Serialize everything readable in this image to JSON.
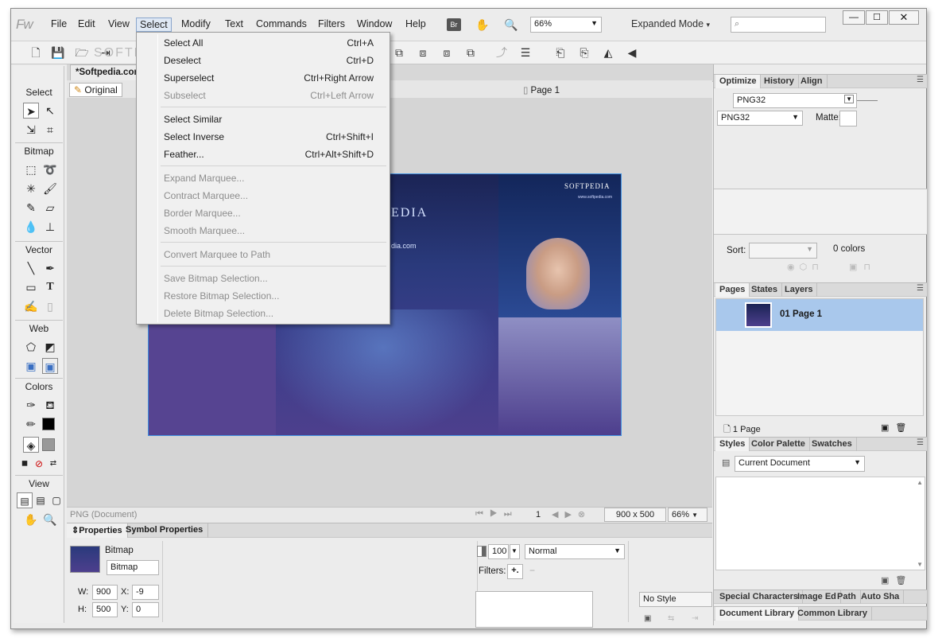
{
  "app": {
    "logo": "Fw",
    "title_close": "✕"
  },
  "menubar": {
    "items": [
      "File",
      "Edit",
      "View",
      "Select",
      "Modify",
      "Text",
      "Commands",
      "Filters",
      "Window",
      "Help"
    ],
    "bridge": "Br",
    "zoom": "66%",
    "mode": "Expanded Mode",
    "search_placeholder": ""
  },
  "toolbar": {
    "watermark": "SOFTPEDIA"
  },
  "tools": {
    "sections": [
      "Select",
      "Bitmap",
      "Vector",
      "Web",
      "Colors",
      "View"
    ]
  },
  "document": {
    "tab_title": "*Softpedia.com",
    "view_original": "Original",
    "page": "Page 1",
    "status_left": "PNG (Document)",
    "frame": "1",
    "size": "900 x 500",
    "zoom": "66%",
    "image_text_title": "SOFTPEDIA",
    "image_text_url": "www.softpedia.com",
    "image_partial_title": "EDIA",
    "image_partial_url": "dia.com"
  },
  "select_menu": {
    "items": [
      {
        "label": "Select All",
        "shortcut": "Ctrl+A",
        "enabled": true
      },
      {
        "label": "Deselect",
        "shortcut": "Ctrl+D",
        "enabled": true
      },
      {
        "label": "Superselect",
        "shortcut": "Ctrl+Right Arrow",
        "enabled": true
      },
      {
        "label": "Subselect",
        "shortcut": "Ctrl+Left Arrow",
        "enabled": false
      },
      {
        "label": "Select Similar",
        "shortcut": "",
        "enabled": true
      },
      {
        "label": "Select Inverse",
        "shortcut": "Ctrl+Shift+I",
        "enabled": true
      },
      {
        "label": "Feather...",
        "shortcut": "Ctrl+Alt+Shift+D",
        "enabled": true
      },
      {
        "label": "Expand Marquee...",
        "shortcut": "",
        "enabled": false
      },
      {
        "label": "Contract Marquee...",
        "shortcut": "",
        "enabled": false
      },
      {
        "label": "Border Marquee...",
        "shortcut": "",
        "enabled": false
      },
      {
        "label": "Smooth Marquee...",
        "shortcut": "",
        "enabled": false
      },
      {
        "label": "Convert Marquee to Path",
        "shortcut": "",
        "enabled": false
      },
      {
        "label": "Save Bitmap Selection...",
        "shortcut": "",
        "enabled": false
      },
      {
        "label": "Restore Bitmap Selection...",
        "shortcut": "",
        "enabled": false
      },
      {
        "label": "Delete Bitmap Selection...",
        "shortcut": "",
        "enabled": false
      }
    ]
  },
  "properties": {
    "tabs": [
      "Properties",
      "Symbol Properties"
    ],
    "type": "Bitmap",
    "name": "Bitmap",
    "w_label": "W:",
    "w": "900",
    "h_label": "H:",
    "h": "500",
    "x_label": "X:",
    "x": "-9",
    "y_label": "Y:",
    "y": "0",
    "opacity": "100",
    "blend": "Normal",
    "filters_label": "Filters:",
    "style": "No Style"
  },
  "optimize_panel": {
    "tabs": [
      "Optimize",
      "History",
      "Align"
    ],
    "format_top": "PNG32",
    "format": "PNG32",
    "matte_label": "Matte:",
    "sort_label": "Sort:",
    "colors": "0 colors"
  },
  "pages_panel": {
    "tabs": [
      "Pages",
      "States",
      "Layers"
    ],
    "page_name": "01  Page 1",
    "count": "1 Page"
  },
  "styles_panel": {
    "tabs": [
      "Styles",
      "Color Palette",
      "Swatches"
    ],
    "source": "Current Document"
  },
  "bottom_tabs_1": [
    "Special Characters",
    "Image Ed",
    "Path",
    "Auto Sha"
  ],
  "bottom_tabs_2": [
    "Document Library",
    "Common Library"
  ]
}
